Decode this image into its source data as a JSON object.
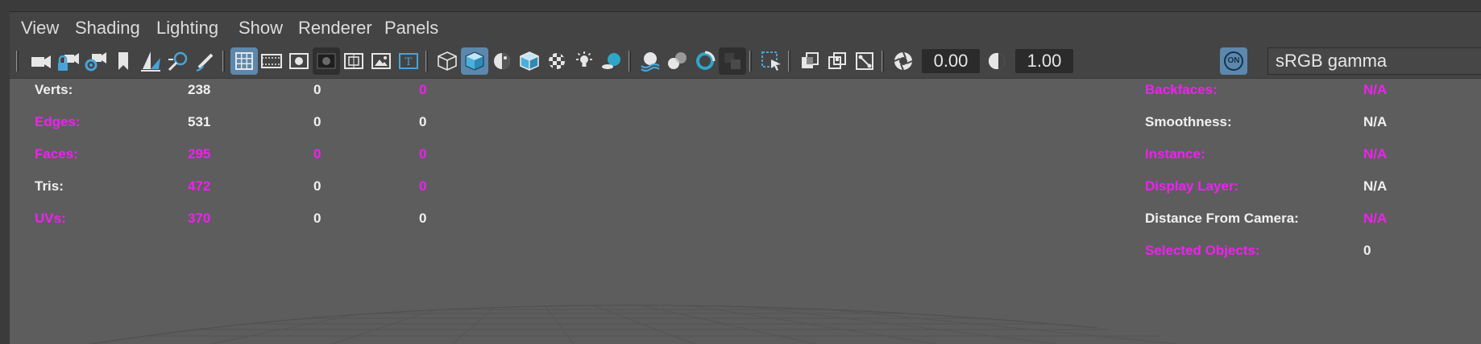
{
  "menubar": {
    "items": [
      "View",
      "Shading",
      "Lighting",
      "Show",
      "Renderer",
      "Panels"
    ]
  },
  "toolbar": {
    "icons": {
      "camera": "camera-icon",
      "lock_camera": "lock-camera-icon",
      "camera_attributes": "camera-attributes-icon",
      "bookmark": "bookmark-icon",
      "image_plane": "image-plane-icon",
      "two_d_pan_zoom": "2d-pan-zoom-icon",
      "grease_pencil": "grease-pencil-icon",
      "grid": "grid-icon",
      "film_gate": "film-gate-icon",
      "resolution_gate": "resolution-gate-icon",
      "gate_mask": "gate-mask-icon",
      "field_chart": "field-chart-icon",
      "safe_action": "safe-action-icon",
      "safe_title": "safe-title-icon",
      "wireframe": "wireframe-cube-icon",
      "smooth_shade": "smooth-shade-cube-icon",
      "default_material": "default-material-icon",
      "wireframe_on_shaded": "wireframe-on-shaded-icon",
      "textured": "checker-texture-icon",
      "use_all_lights": "light-bulb-icon",
      "shadows": "shadows-icon",
      "screen_space_ao": "ambient-occlusion-icon",
      "motion_blur": "motion-blur-icon",
      "multisample_aa": "anti-aliasing-icon",
      "depth_of_field": "depth-of-field-icon",
      "isolate_select": "isolate-select-icon",
      "xray": "xray-icon",
      "xray_active": "xray-active-components-icon",
      "xray_joints": "xray-joints-icon",
      "exposure": "exposure-icon",
      "gamma": "gamma-icon",
      "color_management": "color-management-on-icon"
    },
    "exposure_value": "0.00",
    "gamma_value": "1.00",
    "color_mgmt_label": "ON",
    "color_space": "sRGB gamma"
  },
  "hud": {
    "left_rows": [
      {
        "label": "Verts:",
        "values": [
          "238",
          "0",
          "0"
        ]
      },
      {
        "label": "Edges:",
        "values": [
          "531",
          "0",
          "0"
        ]
      },
      {
        "label": "Faces:",
        "values": [
          "295",
          "0",
          "0"
        ]
      },
      {
        "label": "Tris:",
        "values": [
          "472",
          "0",
          "0"
        ]
      },
      {
        "label": "UVs:",
        "values": [
          "370",
          "0",
          "0"
        ]
      }
    ],
    "right_rows": [
      {
        "label": "Backfaces:",
        "value": "N/A"
      },
      {
        "label": "Smoothness:",
        "value": "N/A"
      },
      {
        "label": "Instance:",
        "value": "N/A"
      },
      {
        "label": "Display Layer:",
        "value": "N/A"
      },
      {
        "label": "Distance From Camera:",
        "value": "N/A"
      },
      {
        "label": "Selected Objects:",
        "value": "0"
      }
    ]
  },
  "colors": {
    "hud_white": "#f0f0f0",
    "hud_magenta": "#f020f0",
    "active_button": "#5d88ad",
    "panel_bg": "#444444",
    "viewport_bg": "#5d5d5d"
  }
}
